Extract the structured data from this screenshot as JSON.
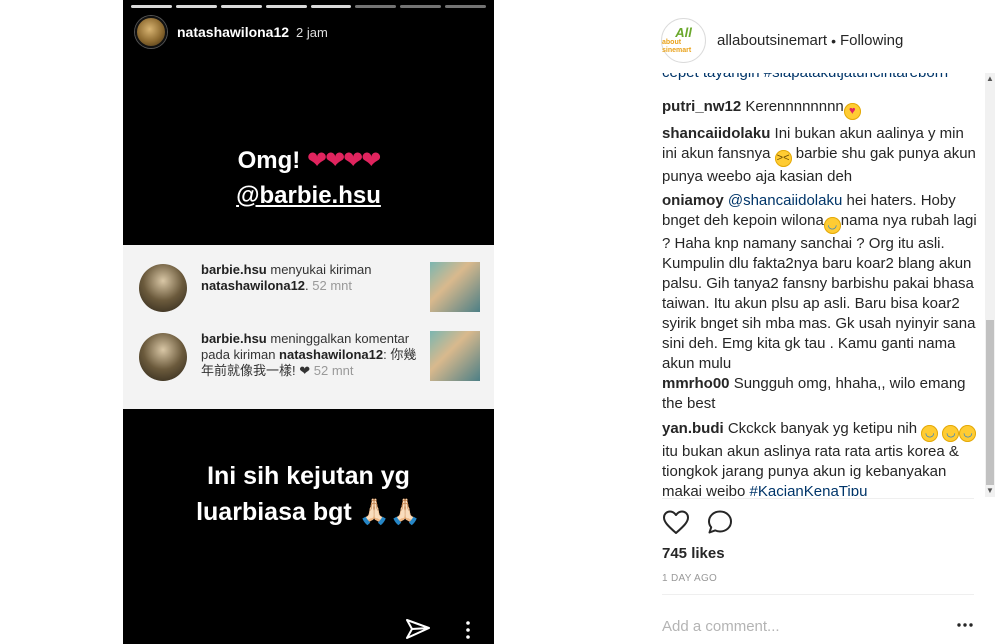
{
  "story": {
    "username": "natashawilona12",
    "time": "2 jam",
    "text1_line1": "Omg!",
    "text1_emoji": "❤❤❤❤",
    "text1_line2": "@barbie.hsu",
    "notifications": [
      {
        "user": "barbie.hsu",
        "text": " menyukai kiriman ",
        "target": "natashawilona12",
        "time": "52 mnt"
      },
      {
        "user": "barbie.hsu",
        "text": " meninggalkan komentar pada kiriman ",
        "target": "natashawilona12",
        "comment": ": 你幾年前就像我一樣! ❤",
        "time": "52 mnt"
      }
    ],
    "text2_line1": "Ini sih kejutan yg",
    "text2_line2": "luarbiasa bgt 🙏🏻🙏🏻"
  },
  "post": {
    "account": "allaboutsinemart",
    "separator": "•",
    "follow_status": "Following",
    "logo_text_top": "All",
    "logo_text_bottom": "about sinemart",
    "partial_comment": "cepet tayangin #siapatakutjatuhcintareborn",
    "comments": [
      {
        "user": "putri_nw12",
        "text": " Kerennnnnnnn",
        "emoji_after": "😍"
      },
      {
        "user": "shancaiidolaku",
        "text": " Ini bukan akun aalinya y min ini akun fansnya ",
        "emoji_mid": "😣",
        "text_after": "barbie shu gak punya akun punya weebo aja kasian deh"
      },
      {
        "user": "oniamoy",
        "mention": "@shancaiidolaku",
        "text": " hei haters. Hoby bnget deh kepoin wilona",
        "emoji_mid": "😂",
        "text_after": "nama nya rubah lagi ? Haha knp namany sanchai ? Org itu asli. Kumpulin dlu fakta2nya baru koar2 blang akun palsu. Gih tanya2 fansny barbishu pakai bhasa taiwan. Itu akun plsu ap asli. Baru bisa koar2 syirik bnget sih mba mas. Gk usah nyinyir sana sini deh. Emg kita gk tau . Kamu ganti nama akun mulu"
      },
      {
        "user": "mmrho00",
        "text": " Sungguh omg, hhaha,, wilo emang the best"
      },
      {
        "user": "yan.budi",
        "text": " Ckckck banyak yg ketipu nih ",
        "emoji_mid": "😂",
        "text_after": "itu bukan akun aslinya rata rata artis korea & tiongkok jarang punya akun ig kebanyakan makai weibo ",
        "hashtag": "#KacianKenaTipu"
      }
    ],
    "likes": "745 likes",
    "age": "1 DAY AGO",
    "add_comment_placeholder": "Add a comment..."
  }
}
